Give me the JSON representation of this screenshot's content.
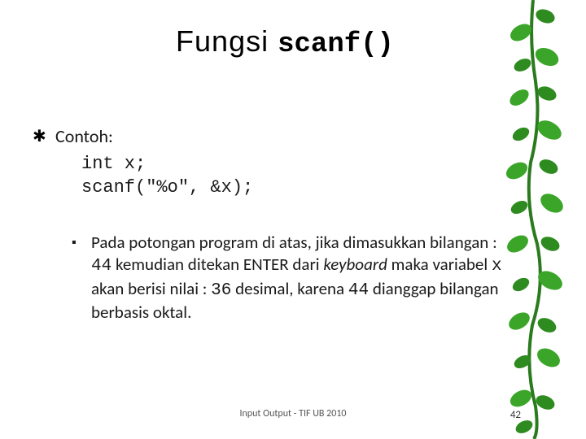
{
  "title_prefix": "Fungsi ",
  "title_mono": "scanf()",
  "main_bullet_label": "Contoh:",
  "code_line1": "int x;",
  "code_line2": "scanf(\"%o\", &x);",
  "sub_text_1": "Pada potongan program di atas, jika dimasukkan bilangan : ",
  "sub_num_1": "44",
  "sub_text_2": " kemudian ditekan ENTER dari ",
  "sub_kw_keyboard": "keyboard",
  "sub_text_3": " maka variabel ",
  "sub_var_x": "x",
  "sub_text_4": " akan berisi nilai : ",
  "sub_num_2": "36",
  "sub_text_5": " desimal, karena ",
  "sub_num_3": "44",
  "sub_text_6": " dianggap bilangan berbasis oktal.",
  "footer": "Input Output - TIF UB 2010",
  "page": "42"
}
